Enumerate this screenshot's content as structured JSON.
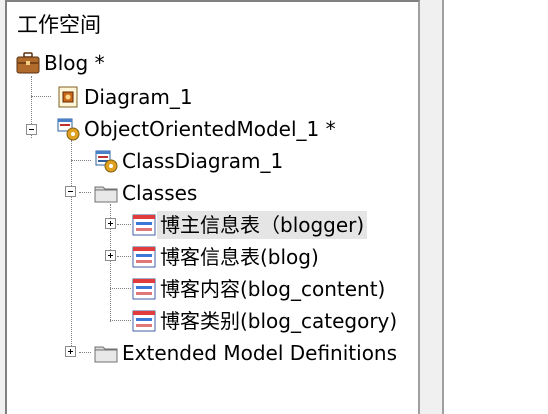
{
  "tree": {
    "root_label": "工作空间",
    "nodes": [
      {
        "label": "Blog *",
        "icon": "briefcase-icon"
      },
      {
        "label": "Diagram_1",
        "icon": "diagram-icon"
      },
      {
        "label": "ObjectOrientedModel_1 *",
        "icon": "model-icon"
      },
      {
        "label": "ClassDiagram_1",
        "icon": "class-diagram-icon"
      },
      {
        "label": "Classes",
        "icon": "folder-icon"
      },
      {
        "label": "博主信息表（blogger)",
        "icon": "class-icon"
      },
      {
        "label": "博客信息表(blog)",
        "icon": "class-icon"
      },
      {
        "label": "博客内容(blog_content)",
        "icon": "class-icon"
      },
      {
        "label": "博客类别(blog_category)",
        "icon": "class-icon"
      },
      {
        "label": "Extended Model Definitions",
        "icon": "folder-icon"
      }
    ]
  },
  "colors": {
    "selection": "#e5e5e5",
    "folder": "#d8d8d8",
    "class_stripe_red": "#e03c3c",
    "class_stripe_blue": "#3c78d8"
  }
}
